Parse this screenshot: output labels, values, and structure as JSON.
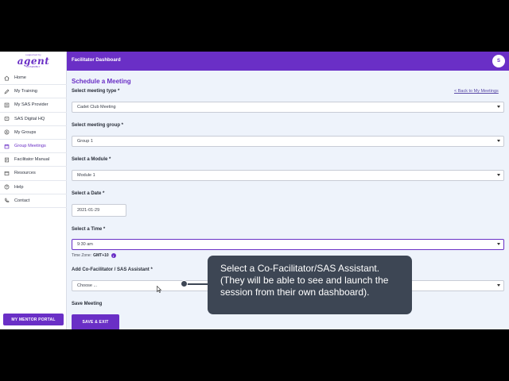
{
  "logo": {
    "top": "supported by",
    "main": "agent",
    "bottom": "ASSEMBLY"
  },
  "sidebar": {
    "items": [
      {
        "label": "Home",
        "icon": "home-icon"
      },
      {
        "label": "My Training",
        "icon": "pencil-icon"
      },
      {
        "label": "My SAS Provider",
        "icon": "provider-icon"
      },
      {
        "label": "SAS Digital HQ",
        "icon": "hq-icon"
      },
      {
        "label": "My Groups",
        "icon": "groups-icon"
      },
      {
        "label": "Group Meetings",
        "icon": "calendar-icon",
        "active": true
      },
      {
        "label": "Facilitator Manual",
        "icon": "manual-icon"
      },
      {
        "label": "Resources",
        "icon": "resources-icon"
      },
      {
        "label": "Help",
        "icon": "help-icon"
      },
      {
        "label": "Contact",
        "icon": "contact-icon"
      }
    ],
    "mentor_button": "MY MENTOR PORTAL"
  },
  "header": {
    "title": "Facilitator Dashboard",
    "avatar_initial": "S"
  },
  "form": {
    "title": "Schedule a Meeting",
    "back_link": "< Back to My Meetings",
    "meeting_type": {
      "label": "Select meeting type *",
      "value": "Cadet Club Meeting"
    },
    "meeting_group": {
      "label": "Select meeting group *",
      "value": "Group 1"
    },
    "module": {
      "label": "Select a Module *",
      "value": "Module 1"
    },
    "date": {
      "label": "Select a Date *",
      "value": "2021-01-29"
    },
    "time": {
      "label": "Select a Time *",
      "value": "9:30 am"
    },
    "timezone": {
      "label": "Time Zone:",
      "value": "GMT+10",
      "info_icon": "i"
    },
    "cofacilitator": {
      "label": "Add Co-Facilitator / SAS Assistant *",
      "value": "Choose ..."
    },
    "save_heading": "Save Meeting",
    "save_button": "SAVE & EXIT"
  },
  "tooltip": {
    "line1": "Select a Co-Facilitator/SAS Assistant.",
    "line2": "(They will be able to see and launch the",
    "line3": "session from their own dashboard)."
  },
  "colors": {
    "accent": "#6a2fc6",
    "tooltip_bg": "#3d4654",
    "page_bg": "#eef3fb"
  }
}
